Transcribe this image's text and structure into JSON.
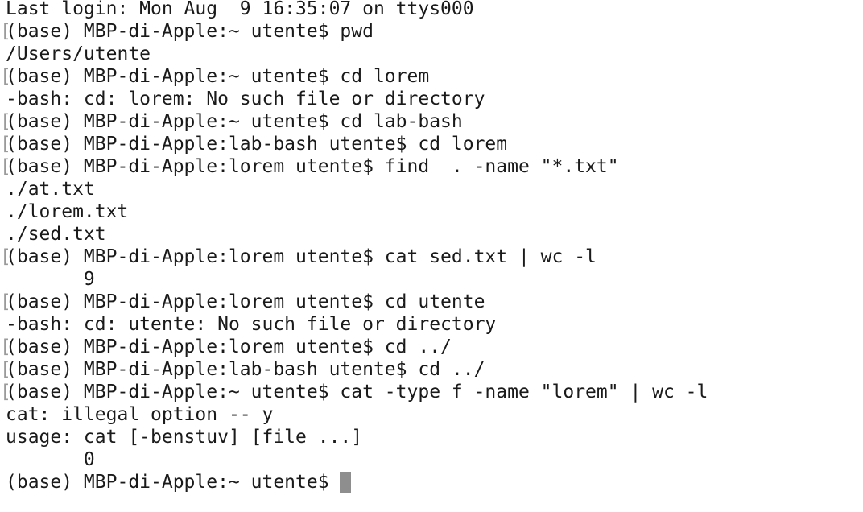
{
  "terminal": {
    "lines": [
      {
        "text": "Last login: Mon Aug  9 16:35:07 on ttys000",
        "marked": false
      },
      {
        "text": "(base) MBP-di-Apple:~ utente$ pwd",
        "marked": true
      },
      {
        "text": "/Users/utente",
        "marked": false
      },
      {
        "text": "(base) MBP-di-Apple:~ utente$ cd lorem",
        "marked": true
      },
      {
        "text": "-bash: cd: lorem: No such file or directory",
        "marked": false
      },
      {
        "text": "(base) MBP-di-Apple:~ utente$ cd lab-bash",
        "marked": true
      },
      {
        "text": "(base) MBP-di-Apple:lab-bash utente$ cd lorem",
        "marked": true
      },
      {
        "text": "(base) MBP-di-Apple:lorem utente$ find  . -name \"*.txt\"",
        "marked": true
      },
      {
        "text": "./at.txt",
        "marked": false
      },
      {
        "text": "./lorem.txt",
        "marked": false
      },
      {
        "text": "./sed.txt",
        "marked": false
      },
      {
        "text": "(base) MBP-di-Apple:lorem utente$ cat sed.txt | wc -l",
        "marked": true
      },
      {
        "text": "       9",
        "marked": false
      },
      {
        "text": "(base) MBP-di-Apple:lorem utente$ cd utente",
        "marked": true
      },
      {
        "text": "-bash: cd: utente: No such file or directory",
        "marked": false
      },
      {
        "text": "(base) MBP-di-Apple:lorem utente$ cd ../",
        "marked": true
      },
      {
        "text": "(base) MBP-di-Apple:lab-bash utente$ cd ../",
        "marked": true
      },
      {
        "text": "(base) MBP-di-Apple:~ utente$ cat -type f -name \"lorem\" | wc -l",
        "marked": true
      },
      {
        "text": "cat: illegal option -- y",
        "marked": false
      },
      {
        "text": "usage: cat [-benstuv] [file ...]",
        "marked": false
      },
      {
        "text": "       0",
        "marked": false
      }
    ],
    "prompt": "(base) MBP-di-Apple:~ utente$ ",
    "mark_glyph": "[",
    "colors": {
      "background": "#ffffff",
      "text": "#1a1a1a",
      "cursor": "#8e8e8e",
      "mark": "#9a9a9a"
    }
  }
}
